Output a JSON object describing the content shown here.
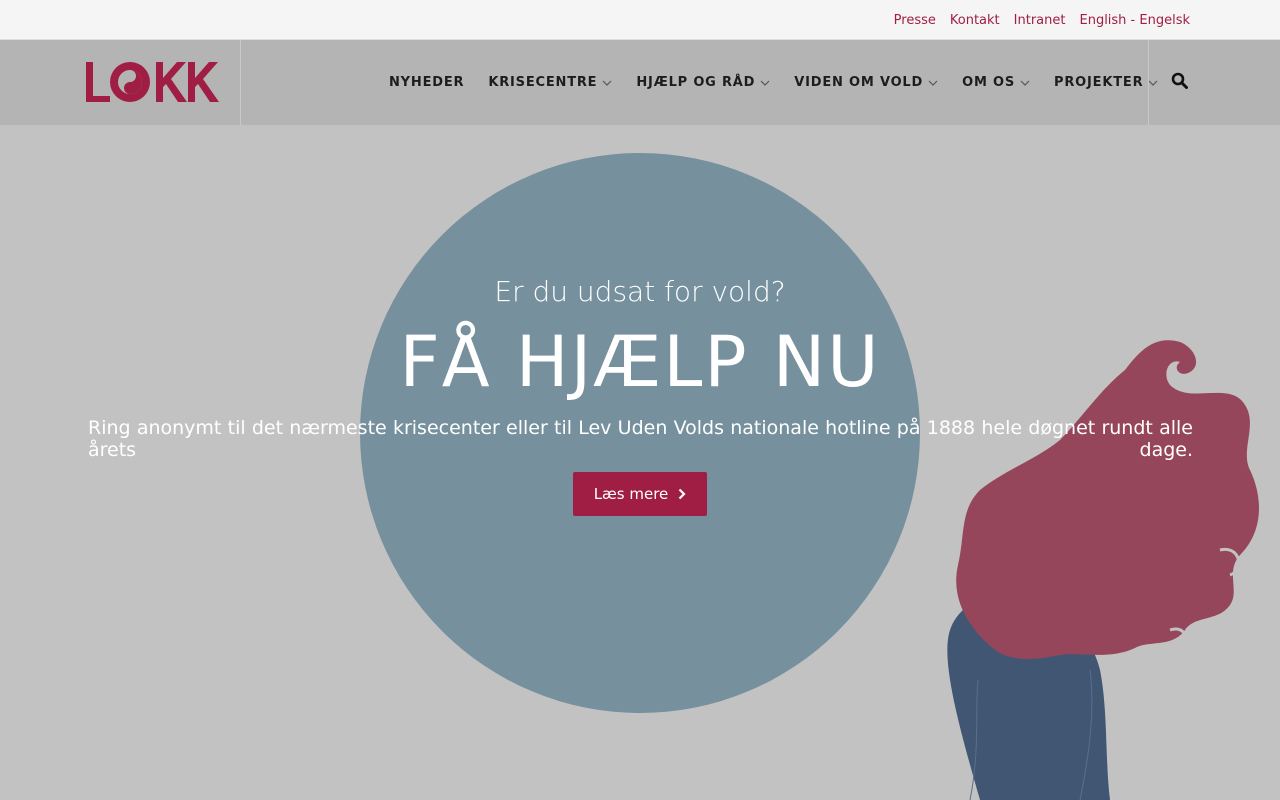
{
  "topbar": {
    "links": [
      "Presse",
      "Kontakt",
      "Intranet",
      "English - Engelsk"
    ]
  },
  "header": {
    "logo_text": "LOKK",
    "nav": [
      {
        "label": "NYHEDER",
        "has_dropdown": false
      },
      {
        "label": "KRISECENTRE",
        "has_dropdown": true
      },
      {
        "label": "HJÆLP OG RÅD",
        "has_dropdown": true
      },
      {
        "label": "VIDEN OM VOLD",
        "has_dropdown": true
      },
      {
        "label": "OM OS",
        "has_dropdown": true
      },
      {
        "label": "PROJEKTER",
        "has_dropdown": true
      }
    ],
    "search_icon": "search-icon"
  },
  "hero": {
    "pre_title": "Er du udsat for vold?",
    "title": "FÅ HJÆLP NU",
    "text": "Ring anonymt til det nærmeste krisecenter eller til Lev Uden Volds nationale hotline på 1888 hele døgnet rundt alle årets dage.",
    "cta_label": "Læs mere"
  },
  "colors": {
    "accent": "#a01e44",
    "circle": "#76909e",
    "hero_bg": "#c2c2c2",
    "hair": "#96465a",
    "sweater": "#405673"
  }
}
